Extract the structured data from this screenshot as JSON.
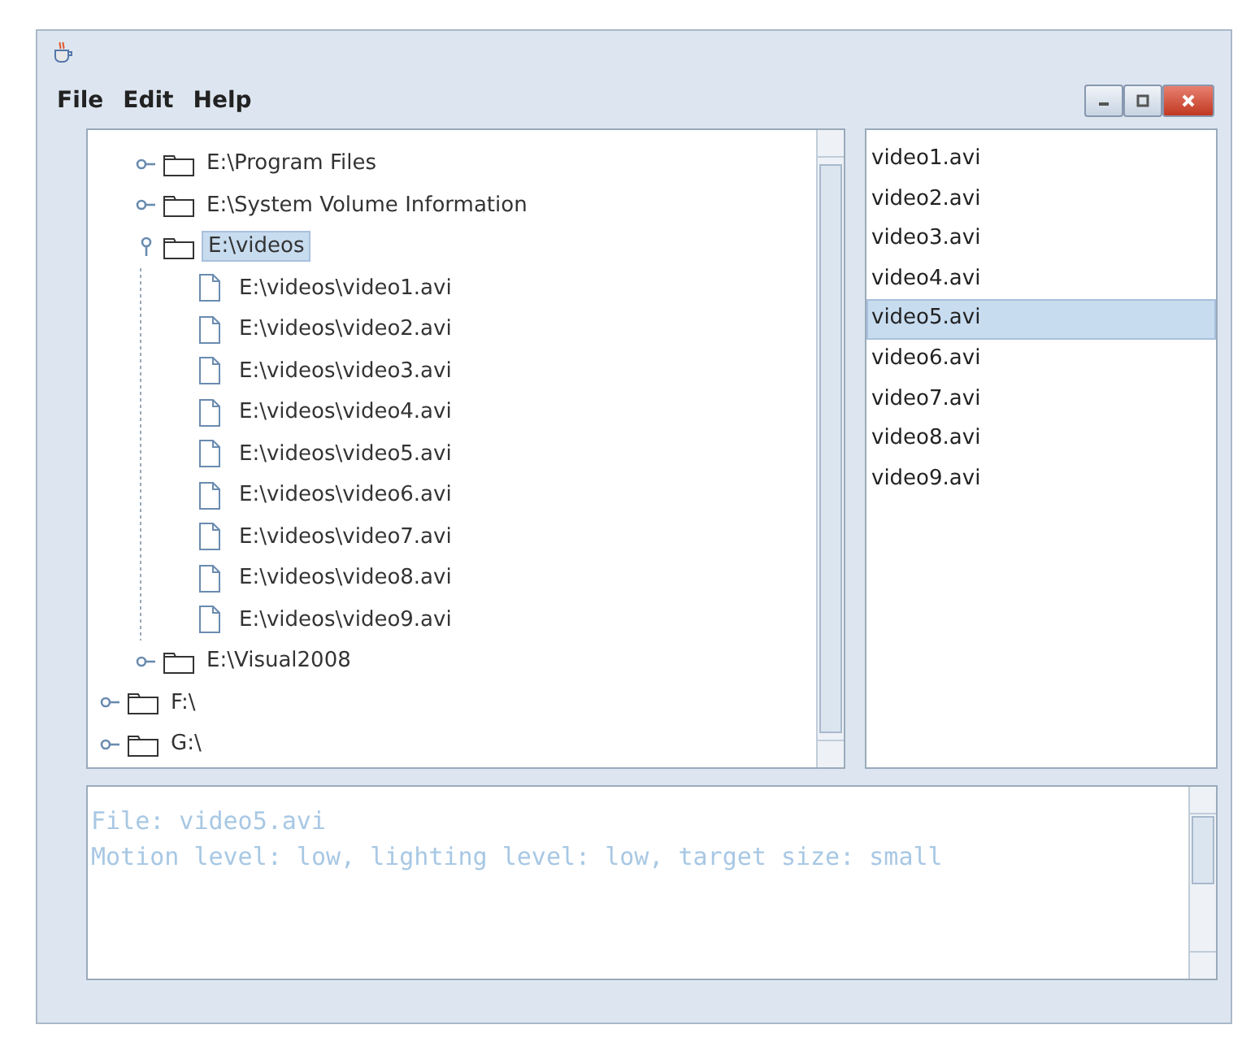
{
  "menu": [
    {
      "label": "File"
    },
    {
      "label": "Edit"
    },
    {
      "label": "Help"
    }
  ],
  "tree": {
    "items": [
      {
        "children": [
          {
            "label": "E:\\Program Files",
            "kind": "folder",
            "expanded": false,
            "selected": false
          },
          {
            "label": "E:\\System Volume Information",
            "kind": "folder",
            "expanded": false,
            "selected": false
          },
          {
            "label": "E:\\videos",
            "kind": "folder",
            "expanded": true,
            "selected": true,
            "children": [
              {
                "label": "E:\\videos\\video1.avi",
                "kind": "file",
                "selected": false
              },
              {
                "label": "E:\\videos\\video2.avi",
                "kind": "file",
                "selected": false
              },
              {
                "label": "E:\\videos\\video3.avi",
                "kind": "file",
                "selected": false
              },
              {
                "label": "E:\\videos\\video4.avi",
                "kind": "file",
                "selected": false
              },
              {
                "label": "E:\\videos\\video5.avi",
                "kind": "file",
                "selected": false
              },
              {
                "label": "E:\\videos\\video6.avi",
                "kind": "file",
                "selected": false
              },
              {
                "label": "E:\\videos\\video7.avi",
                "kind": "file",
                "selected": false
              },
              {
                "label": "E:\\videos\\video8.avi",
                "kind": "file",
                "selected": false
              },
              {
                "label": "E:\\videos\\video9.avi",
                "kind": "file",
                "selected": false
              }
            ]
          },
          {
            "label": "E:\\Visual2008",
            "kind": "folder",
            "expanded": false,
            "selected": false
          }
        ]
      },
      {
        "label": "F:\\",
        "kind": "folder",
        "expanded": false,
        "selected": false
      },
      {
        "label": "G:\\",
        "kind": "folder",
        "expanded": false,
        "selected": false
      }
    ]
  },
  "list": [
    {
      "label": "video1.avi",
      "selected": false
    },
    {
      "label": "video2.avi",
      "selected": false
    },
    {
      "label": "video3.avi",
      "selected": false
    },
    {
      "label": "video4.avi",
      "selected": false
    },
    {
      "label": "video5.avi",
      "selected": true
    },
    {
      "label": "video6.avi",
      "selected": false
    },
    {
      "label": "video7.avi",
      "selected": false
    },
    {
      "label": "video8.avi",
      "selected": false
    },
    {
      "label": "video9.avi",
      "selected": false
    }
  ],
  "info": {
    "lines": [
      "File: video5.avi",
      "Motion level: low, lighting level: low, target size: small"
    ]
  }
}
